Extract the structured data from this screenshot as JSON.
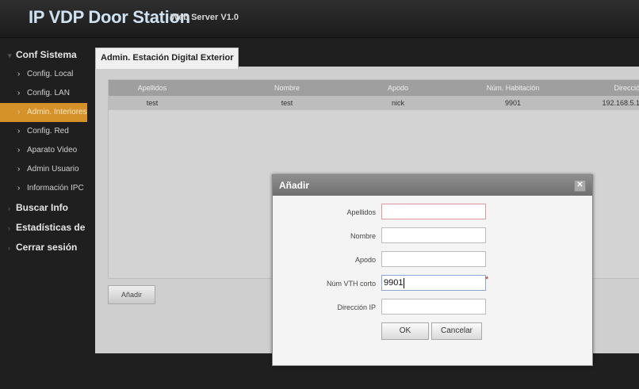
{
  "header": {
    "title": "IP VDP Door Station",
    "subtitle": "Web Server V1.0"
  },
  "sidebar": {
    "sections": [
      {
        "label": "Conf Sistema",
        "items": [
          {
            "label": "Config. Local",
            "active": false
          },
          {
            "label": "Config. LAN",
            "active": false
          },
          {
            "label": "Admin. Interiores",
            "active": true
          },
          {
            "label": "Config. Red",
            "active": false
          },
          {
            "label": "Aparato Video",
            "active": false
          },
          {
            "label": "Admin Usuario",
            "active": false
          },
          {
            "label": "Información IPC",
            "active": false
          }
        ]
      },
      {
        "label": "Buscar Info"
      },
      {
        "label": "Estadísticas de"
      },
      {
        "label": "Cerrar sesión"
      }
    ]
  },
  "tab": {
    "label": "Admin. Estación Digital Exterior"
  },
  "table": {
    "columns": [
      "Apellidos",
      "Nombre",
      "Apodo",
      "Núm. Habitación",
      "Dirección I"
    ],
    "rows": [
      [
        "test",
        "test",
        "nick",
        "9901",
        "192.168.5.1"
      ]
    ]
  },
  "add_button": "Añadir",
  "dialog": {
    "title": "Añadir",
    "close_icon": "close-icon",
    "fields": [
      {
        "label": "Apellidos",
        "value": ""
      },
      {
        "label": "Nombre",
        "value": ""
      },
      {
        "label": "Apodo",
        "value": ""
      },
      {
        "label": "Núm VTH corto",
        "value": "9901",
        "required_mark": "*"
      },
      {
        "label": "Dirección IP",
        "value": ""
      }
    ],
    "ok": "OK",
    "cancel": "Cancelar"
  }
}
